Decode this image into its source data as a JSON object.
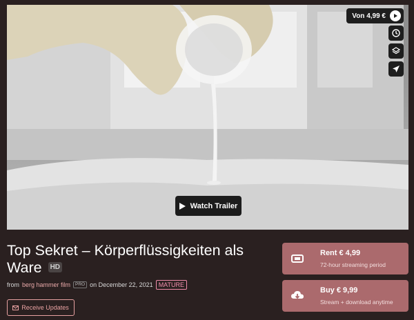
{
  "player": {
    "price_label": "Von 4,99 €",
    "trailer_label": "Watch Trailer",
    "side_icons": [
      "clock-icon",
      "layers-icon",
      "send-icon"
    ]
  },
  "film": {
    "title": "Top Sekret – Körperflüssigkeiten als Ware",
    "quality_badge": "HD",
    "from_label": "from",
    "author": "berg hammer film",
    "author_badge": "PRO",
    "date_label": "on December 22, 2021",
    "rating_badge": "MATURE"
  },
  "updates": {
    "label": "Receive Updates"
  },
  "actions": {
    "rent": {
      "title": "Rent € 4,99",
      "subtitle": "72-hour streaming period"
    },
    "buy": {
      "title": "Buy € 9,99",
      "subtitle": "Stream + download anytime"
    }
  },
  "colors": {
    "background": "#2a2020",
    "action": "#ab6a6d",
    "accent_link": "#e9a9a9",
    "mature": "#f08dab"
  }
}
